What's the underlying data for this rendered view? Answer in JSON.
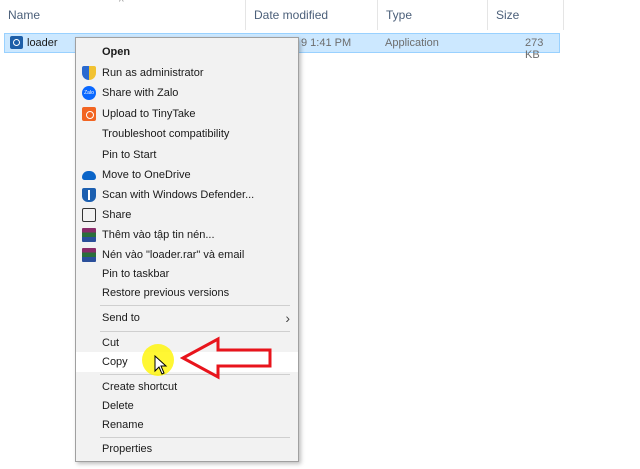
{
  "columns": {
    "name": "Name",
    "date_modified": "Date modified",
    "type": "Type",
    "size": "Size"
  },
  "file": {
    "name": "loader",
    "date_partial": "9 1:41 PM",
    "type": "Application",
    "size": "273 KB",
    "icon": "app-icon"
  },
  "menu": {
    "open": "Open",
    "run_admin": "Run as administrator",
    "share_zalo": "Share with Zalo",
    "upload_tinytake": "Upload to TinyTake",
    "troubleshoot": "Troubleshoot compatibility",
    "pin_start": "Pin to Start",
    "move_onedrive": "Move to OneDrive",
    "scan_defender": "Scan with Windows Defender...",
    "share": "Share",
    "add_archive": "Thêm vào tập tin nén...",
    "compress_email": "Nén vào \"loader.rar\" và email",
    "pin_taskbar": "Pin to taskbar",
    "restore_versions": "Restore previous versions",
    "send_to": "Send to",
    "cut": "Cut",
    "copy": "Copy",
    "create_shortcut": "Create shortcut",
    "delete": "Delete",
    "rename": "Rename",
    "properties": "Properties"
  },
  "colors": {
    "selection": "#cce8ff",
    "menu_bg": "#f2f2f2",
    "arrow": "#e8141c",
    "cursor_highlight": "#fff500"
  }
}
